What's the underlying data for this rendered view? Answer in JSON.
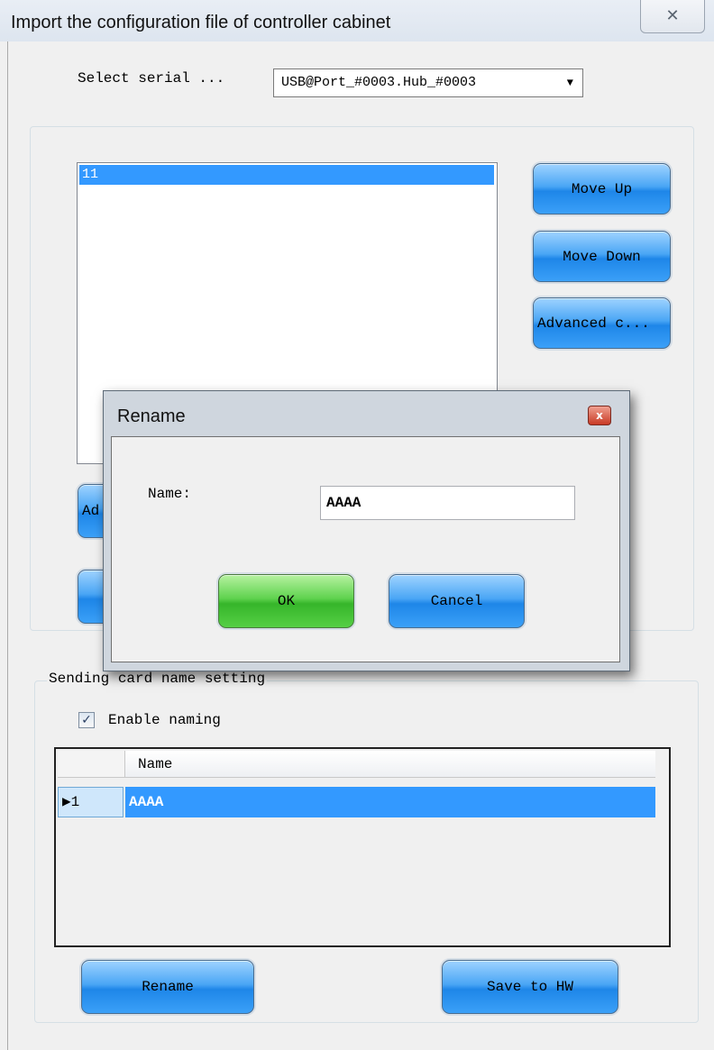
{
  "window": {
    "title": "Import the configuration file of controller cabinet",
    "close_glyph": "✕"
  },
  "serial": {
    "label": "Select serial ...",
    "selected": "USB@Port_#0003.Hub_#0003",
    "arrow_glyph": "▼"
  },
  "config_list": {
    "items": [
      "11"
    ]
  },
  "side_buttons": {
    "move_up": "Move Up",
    "move_down": "Move Down",
    "advanced": "Advanced c...",
    "add_partial": "Ad"
  },
  "rename_dialog": {
    "title": "Rename",
    "close_glyph": "x",
    "name_label": "Name:",
    "name_value": "AAAA",
    "ok": "OK",
    "cancel": "Cancel"
  },
  "naming": {
    "group_label": "Sending card name setting",
    "enable_label": "Enable naming",
    "enable_checked": true,
    "check_glyph": "✓",
    "column_header": "Name",
    "rows": [
      {
        "index": "▶1",
        "name": "AAAA"
      }
    ],
    "rename_button": "Rename",
    "save_button": "Save to HW"
  }
}
